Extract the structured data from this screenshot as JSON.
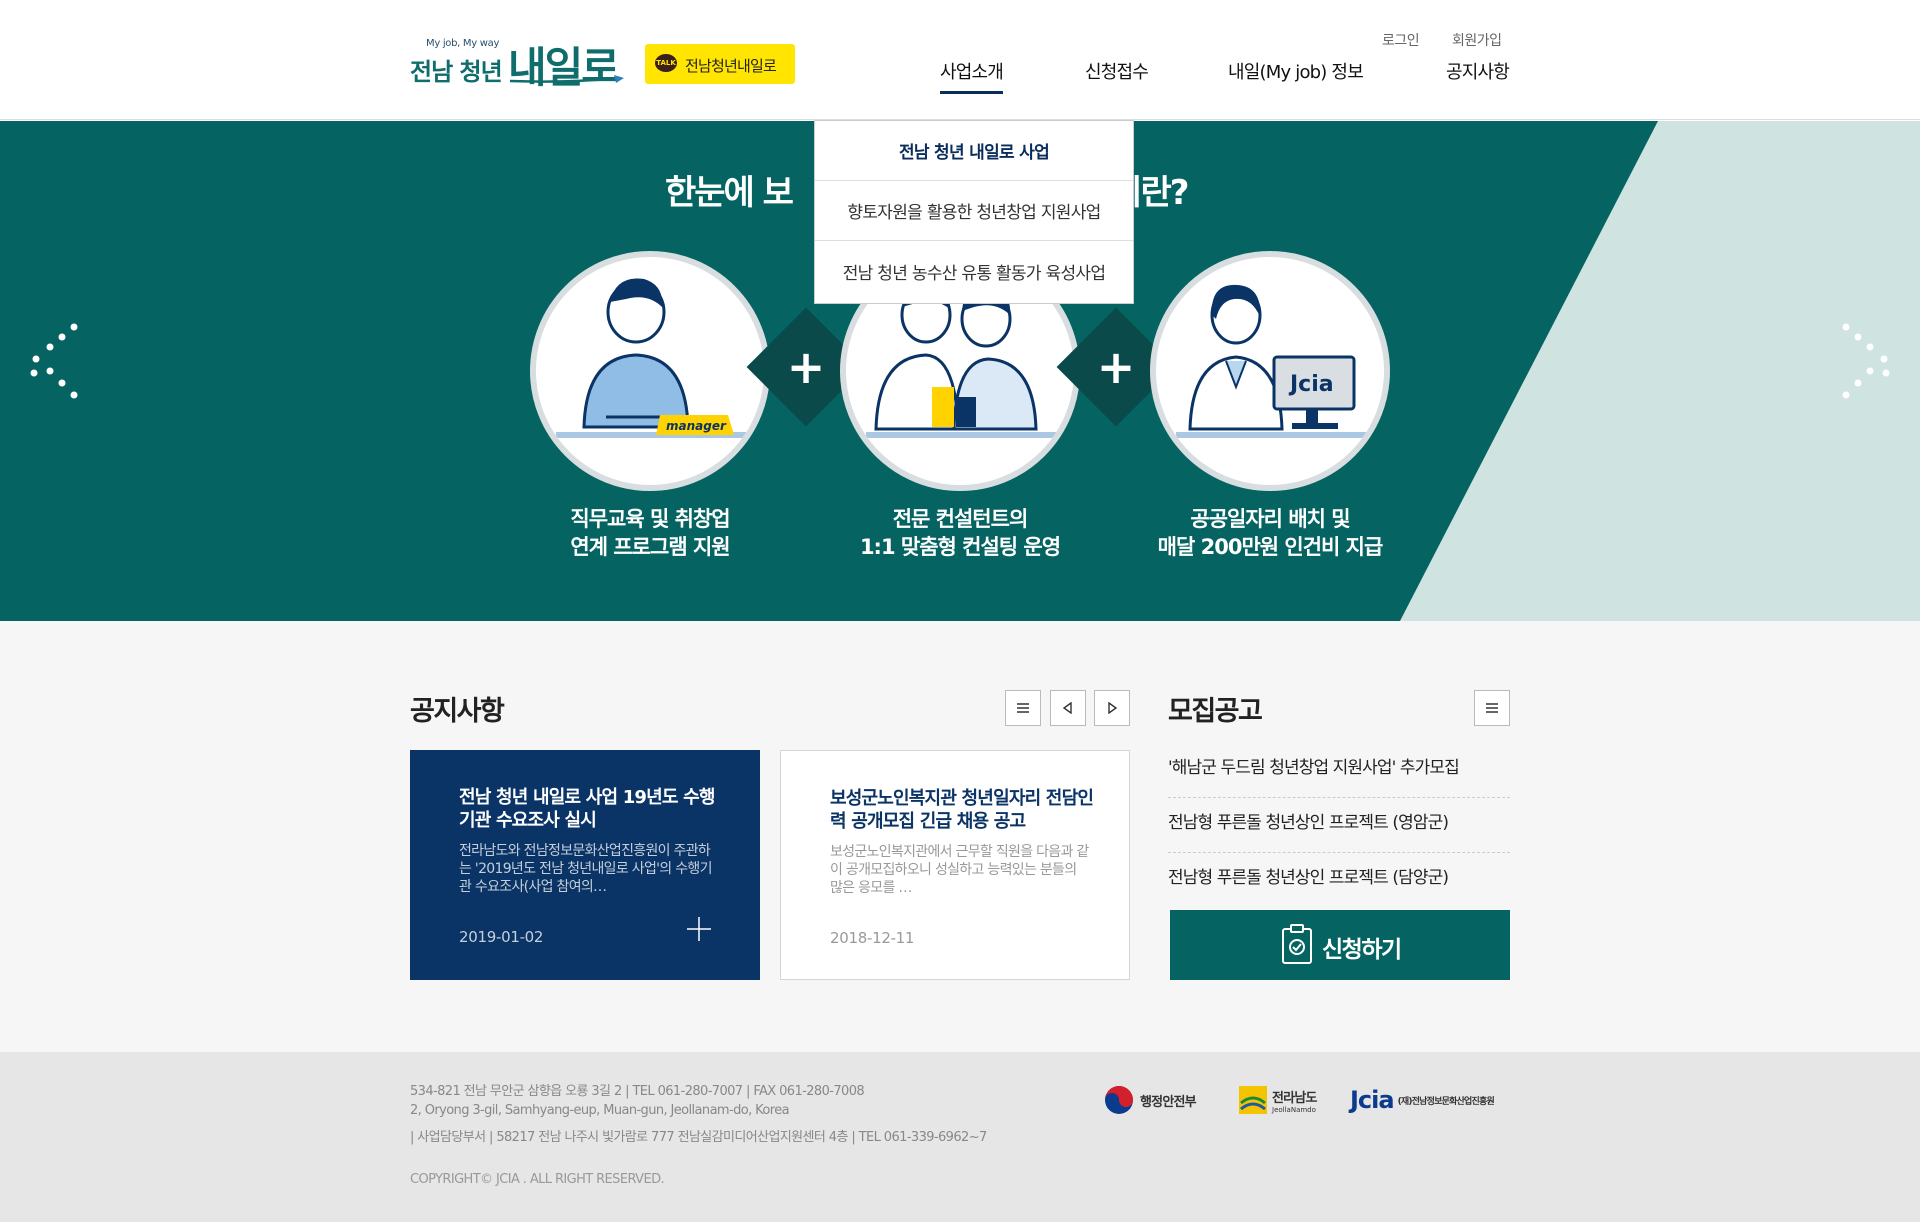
{
  "header": {
    "logo": {
      "tagline": "My job, My way",
      "text_small": "전남 청년",
      "text_big": "내일로"
    },
    "kakao": {
      "badge": "TALK",
      "label": "전남청년내일로"
    },
    "util": {
      "login": "로그인",
      "join": "회원가입"
    },
    "nav": [
      "사업소개",
      "신청접수",
      "내일(My job) 정보",
      "공지사항"
    ],
    "dropdown": [
      "전남 청년 내일로 사업",
      "향토자원을 활용한 청년창업 지원사업",
      "전남 청년 농수산 유통 활동가 육성사업"
    ]
  },
  "banner": {
    "headline_left": "한눈에 보",
    "headline_right": "업이란?",
    "badge_manager": "manager",
    "badge_jcia": "Jcia",
    "captions": [
      [
        "직무교육 및 취창업",
        "연계 프로그램 지원"
      ],
      [
        "전문 컨설턴트의",
        "1:1 맞춤형 컨설팅 운영"
      ],
      [
        "공공일자리 배치 및",
        "매달 200만원 인건비 지급"
      ]
    ],
    "plus": "+"
  },
  "notice": {
    "title": "공지사항",
    "cards": [
      {
        "title": "전남 청년 내일로 사업 19년도 수행기관 수요조사 실시",
        "desc": "전라남도와 전남정보문화산업진흥원이 주관하는 '2019년도 전남 청년내일로 사업'의  수행기관 수요조사(사업 참여의…",
        "date": "2019-01-02"
      },
      {
        "title": "보성군노인복지관 청년일자리 전담인력 공개모집 긴급 채용 공고",
        "desc": "보성군노인복지관에서 근무할 직원을 다음과 같이 공개모집하오니 성실하고 능력있는 분들의 많은 응모를 …",
        "date": "2018-12-11"
      }
    ]
  },
  "recruit": {
    "title": "모집공고",
    "items": [
      "'해남군 두드림 청년창업 지원사업' 추가모집",
      "전남형 푸른돌 청년상인 프로젝트 (영암군)",
      "전남형 푸른돌 청년상인 프로젝트 (담양군)"
    ],
    "apply": "신청하기"
  },
  "footer": {
    "line1": "534-821 전남 무안군 삼향읍 오룡 3길 2  |  TEL 061-280-7007  |  FAX 061-280-7008",
    "line2": "2, Oryong 3-gil, Samhyang-eup, Muan-gun, Jeollanam-do, Korea",
    "line3": "| 사업담당부서 | 58217 전남 나주시 빛가람로 777 전남실감미디어산업지원센터 4층  |  TEL 061-339-6962~7",
    "copyright": "COPYRIGHT© JCIA . ALL RIGHT RESERVED.",
    "logos": {
      "mois": "행정안전부",
      "jeonnam": "전라남도",
      "jeonnam_en": "JeollaNamdo",
      "jcia": "Jcia",
      "jcia_name": "(재)전남정보문화산업진흥원"
    }
  },
  "colors": {
    "teal": "#056362",
    "navy": "#0a3366",
    "light_teal": "#cfe3e1",
    "kakao": "#ffe500"
  }
}
